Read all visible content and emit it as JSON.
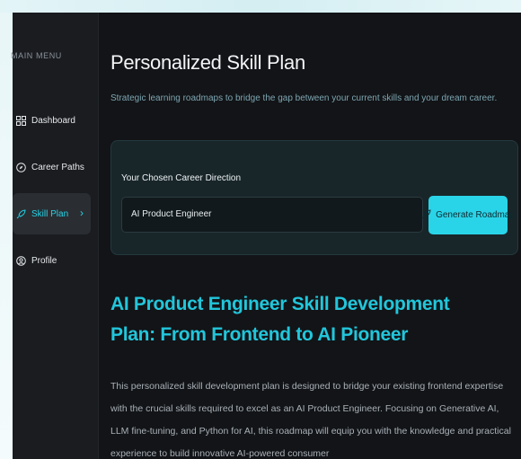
{
  "sidebar": {
    "heading": "MAIN MENU",
    "items": [
      {
        "label": "Dashboard",
        "icon": "dashboard-icon",
        "active": false
      },
      {
        "label": "Career Paths",
        "icon": "compass-icon",
        "active": false
      },
      {
        "label": "Skill Plan",
        "icon": "rocket-icon",
        "active": true
      },
      {
        "label": "Profile",
        "icon": "user-icon",
        "active": false
      }
    ]
  },
  "header": {
    "title": "Personalized Skill Plan",
    "subtitle": "Strategic learning roadmaps to bridge the gap between your current skills and your dream career."
  },
  "career_form": {
    "label": "Your Chosen Career Direction",
    "value": "AI Product Engineer",
    "button_label": "Generate Roadmap"
  },
  "plan": {
    "title": "AI Product Engineer Skill Development Plan: From Frontend to AI Pioneer",
    "body": "This personalized skill development plan is designed to bridge your existing frontend expertise with the crucial skills required to excel as an AI Product Engineer. Focusing on Generative AI, LLM fine-tuning, and Python for AI, this roadmap will equip you with the knowledge and practical experience to build innovative AI-powered consumer"
  },
  "colors": {
    "accent": "#2ad4e8",
    "background": "#121417",
    "sidebar": "#1a1c20",
    "card": "#18262a"
  }
}
